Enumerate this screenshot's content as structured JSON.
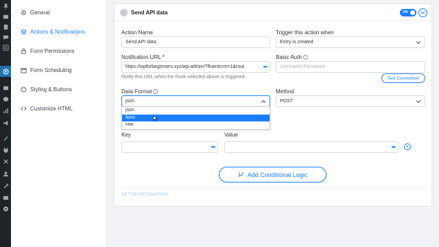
{
  "wp_menu": {
    "icons": [
      "thumbtack-icon",
      "media-icon",
      "pages-icon",
      "comments-icon",
      "forms-icon",
      "fluentforms-icon",
      "woo-icon",
      "products-icon",
      "analytics-icon",
      "marketing-icon",
      "appearance-icon",
      "plugins-icon",
      "users-icon",
      "tools-icon",
      "settings-icon",
      "collapse-icon"
    ]
  },
  "sidebar": {
    "items": [
      {
        "label": "General",
        "icon": "gear-icon"
      },
      {
        "label": "Actions & Notifications",
        "icon": "layers-icon",
        "active": true
      },
      {
        "label": "Form Permissions",
        "icon": "lock-icon"
      },
      {
        "label": "Form Scheduling",
        "icon": "calendar-icon"
      },
      {
        "label": "Styling & Buttons",
        "icon": "palette-icon"
      },
      {
        "label": "Customize HTML",
        "icon": "code-icon"
      }
    ]
  },
  "card": {
    "title": "Send API data",
    "toggle_label": "ON",
    "action_name_label": "Action Name",
    "action_name_value": "Send API data",
    "trigger_label": "Trigger this action when",
    "trigger_value": "Entry is created",
    "notification_url_label": "Notification URL *",
    "notification_url_value": "https://wpforbeginners.xyz/wp-admin/?fluentcrm=1&rout",
    "notification_note": "Notify this URL when the hook selected above is triggered.",
    "basic_auth_label": "Basic Auth",
    "basic_auth_placeholder": "Username:Password",
    "test_button": "Test Connection",
    "data_format_label": "Data Format",
    "data_format_value": "json",
    "data_format_options": [
      "json",
      "form",
      "raw"
    ],
    "data_format_highlighted": "form",
    "method_label": "Method",
    "method_value": "POST",
    "key_label": "Key",
    "value_label": "Value",
    "add_plus": "+",
    "conditional_button": "Add Conditional Logic",
    "setup_automation": "SETUP AUTOMATION"
  },
  "colors": {
    "accent": "#1a7efb",
    "wp_bar": "#1d2327",
    "background": "#f0f2f5"
  }
}
